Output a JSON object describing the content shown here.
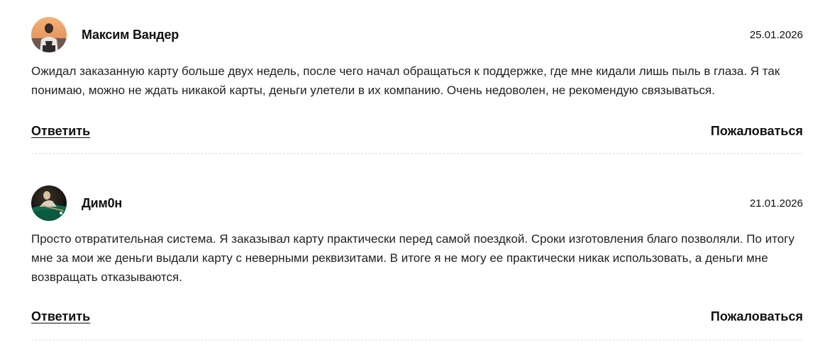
{
  "comments": [
    {
      "author": "Максим Вандер",
      "date": "25.01.2026",
      "text": "Ожидал заказанную карту больше двух недель, после чего начал обращаться к поддержке, где мне кидали лишь пыль в глаза. Я так понимаю, можно не ждать никакой карты, деньги улетели в их компанию. Очень недоволен, не рекомендую связываться.",
      "reply_label": "Ответить",
      "report_label": "Пожаловаться"
    },
    {
      "author": "Дим0н",
      "date": "21.01.2026",
      "text": "Просто отвратительная система. Я заказывал карту практически перед самой поездкой. Сроки изготовления благо позволяли. По итогу мне за мои же деньги выдали карту с неверными реквизитами. В итоге я не могу ее практически никак использовать, а деньги мне возвращать отказываются.",
      "reply_label": "Ответить",
      "report_label": "Пожаловаться"
    }
  ]
}
